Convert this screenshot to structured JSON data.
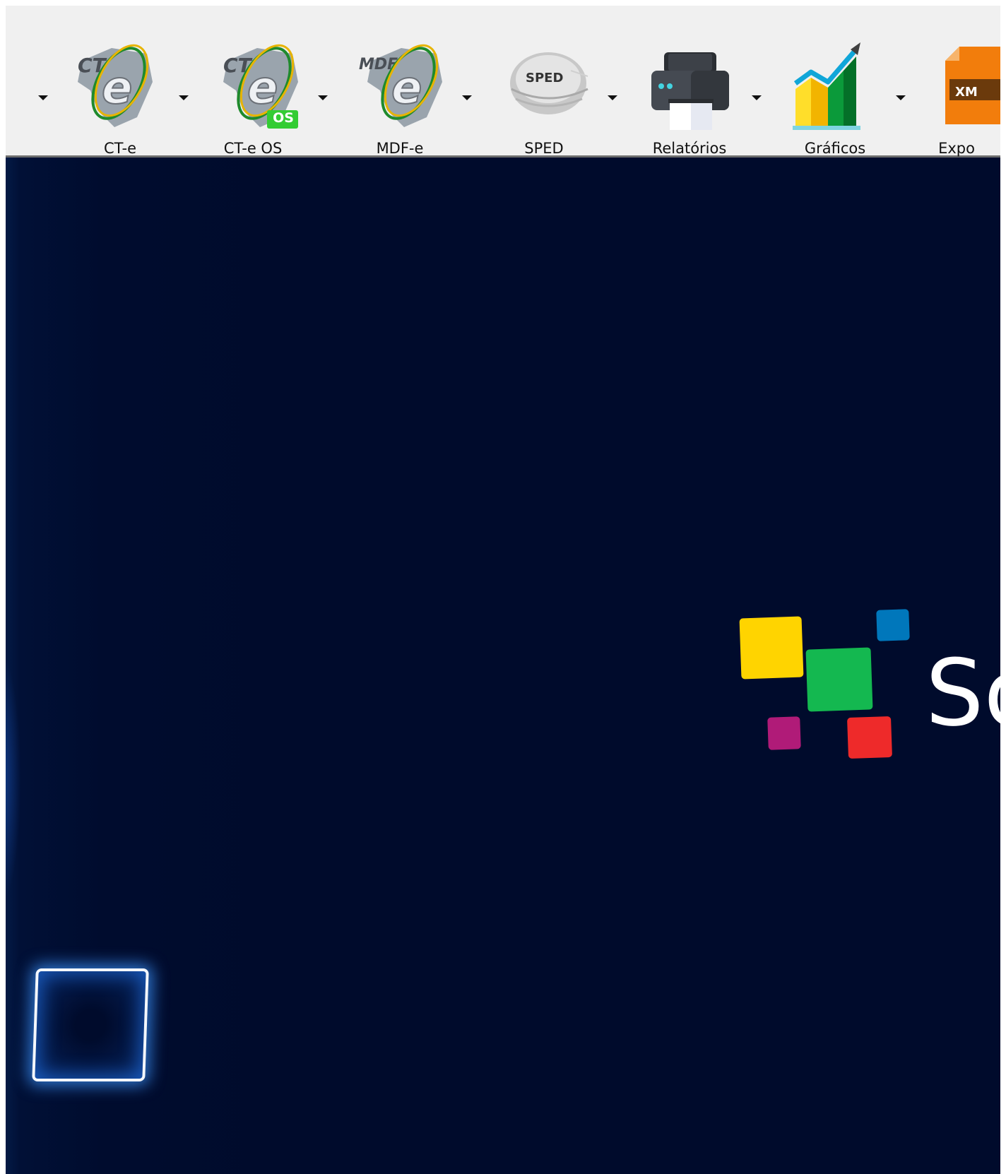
{
  "toolbar": {
    "items": [
      {
        "label": "",
        "icon": "nfe-icon"
      },
      {
        "label": "CT-e",
        "icon": "cte-icon"
      },
      {
        "label": "CT-e OS",
        "icon": "cte-os-icon",
        "badge": "OS"
      },
      {
        "label": "MDF-e",
        "icon": "mdfe-icon"
      },
      {
        "label": "SPED",
        "icon": "sped-icon",
        "icon_text": "SPED"
      },
      {
        "label": "Relatórios",
        "icon": "printer-icon"
      },
      {
        "label": "Gráficos",
        "icon": "bar-chart-icon"
      },
      {
        "label": "Expo",
        "icon": "xml-export-icon",
        "icon_text": "XM"
      }
    ]
  },
  "desktop": {
    "logo_text": "So",
    "logo_colors": [
      "#ffd400",
      "#14b850",
      "#0077bb",
      "#b01b78",
      "#ee2a2a"
    ],
    "background_color": "#000b2c"
  }
}
